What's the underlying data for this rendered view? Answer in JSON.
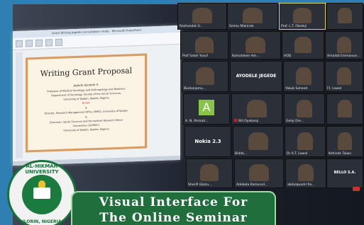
{
  "window": {
    "title": "Grant Writing Jegede Consultation mode - Microsoft PowerPoint"
  },
  "slide": {
    "title": "Writing Grant Proposal",
    "author": "Jegede Ayodele S.",
    "lines": [
      "Professor of Medical Sociology and Anthropology and Bioethics",
      "Department of Sociology, Faculty of the Social Sciences,",
      "University of Ibadan, Ibadan, Nigeria",
      "Email:",
      "&",
      "Director, Research Management Office (RMO), University of Ibadan",
      "&",
      "Chairman, Social Sciences and Humanities Research Ethics",
      "Committee (SSHREC)",
      "University of Ibadan, Ibadan, Nigeria"
    ]
  },
  "gallery": {
    "participants": [
      "Rasheedat O...",
      "Semiu Makinde",
      "Prof. L.T. Oladeji",
      "Prof Salah Yusuf",
      "Kamaldeen Am...",
      "HOD",
      "Amadat Emmanue...",
      "Biodunjamu...",
      "Yakub Saheed",
      "Ft. Lawal",
      "A. N. Ahmad...",
      "Bill Oyebanji",
      "Gelaj Ore...",
      "Nokia 2.3",
      "Bidda...",
      "Dr A.T. Lawal",
      "Kehinde Taiwo",
      "BELLO S.A.",
      "Sherifi Gbolu...",
      "Adebola Kamorud...",
      "abdulquadri Ra..."
    ],
    "active_speaker": "AYODELE JEGEDE",
    "avatar_letter": "A",
    "center_name": "Nokia 2.3"
  },
  "banner": {
    "line1": "Visual Interface For",
    "line2": "The Online Seminar"
  },
  "logo": {
    "top_text": "AL-HIKMAH UNIVERSITY",
    "bottom_text": "ILORIN, NIGERIA"
  }
}
